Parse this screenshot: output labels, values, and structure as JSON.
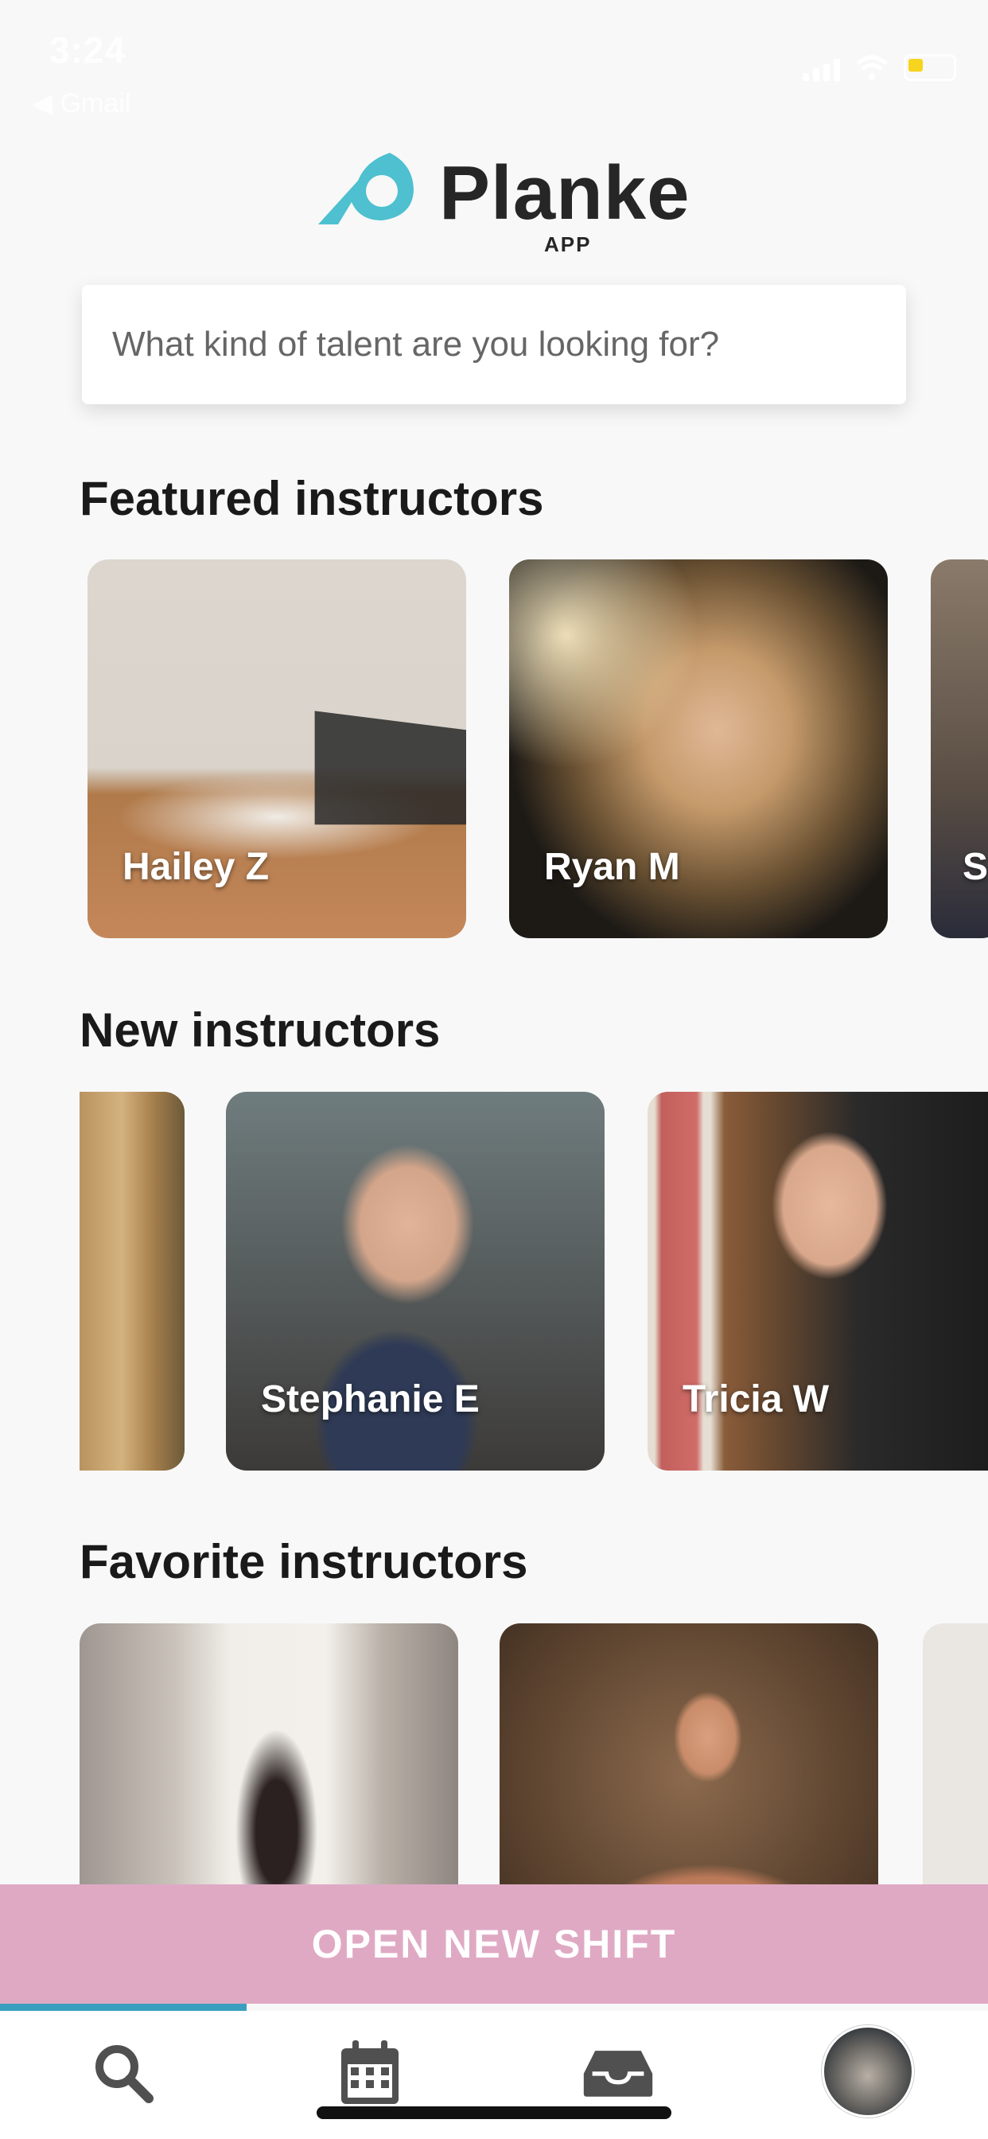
{
  "status_bar": {
    "time": "3:24",
    "back_app": "◀ Gmail"
  },
  "brand": {
    "name": "Planke",
    "sub": "APP",
    "accent": "#4ec0cf"
  },
  "search": {
    "placeholder": "What kind of talent are you looking for?"
  },
  "sections": {
    "featured": {
      "title": "Featured instructors",
      "cards": [
        {
          "name": "Hailey Z"
        },
        {
          "name": "Ryan M"
        },
        {
          "name": "S"
        }
      ]
    },
    "new": {
      "title": "New instructors",
      "cards": [
        {
          "name": ""
        },
        {
          "name": "Stephanie E"
        },
        {
          "name": "Tricia W"
        }
      ]
    },
    "favorite": {
      "title": "Favorite instructors",
      "cards": [
        {
          "name": ""
        },
        {
          "name": ""
        }
      ]
    }
  },
  "cta": {
    "label": "OPEN NEW SHIFT",
    "color": "#dfa9c4"
  },
  "tabs": [
    {
      "icon": "search-icon"
    },
    {
      "icon": "calendar-icon"
    },
    {
      "icon": "inbox-icon"
    },
    {
      "icon": "profile-avatar"
    }
  ]
}
